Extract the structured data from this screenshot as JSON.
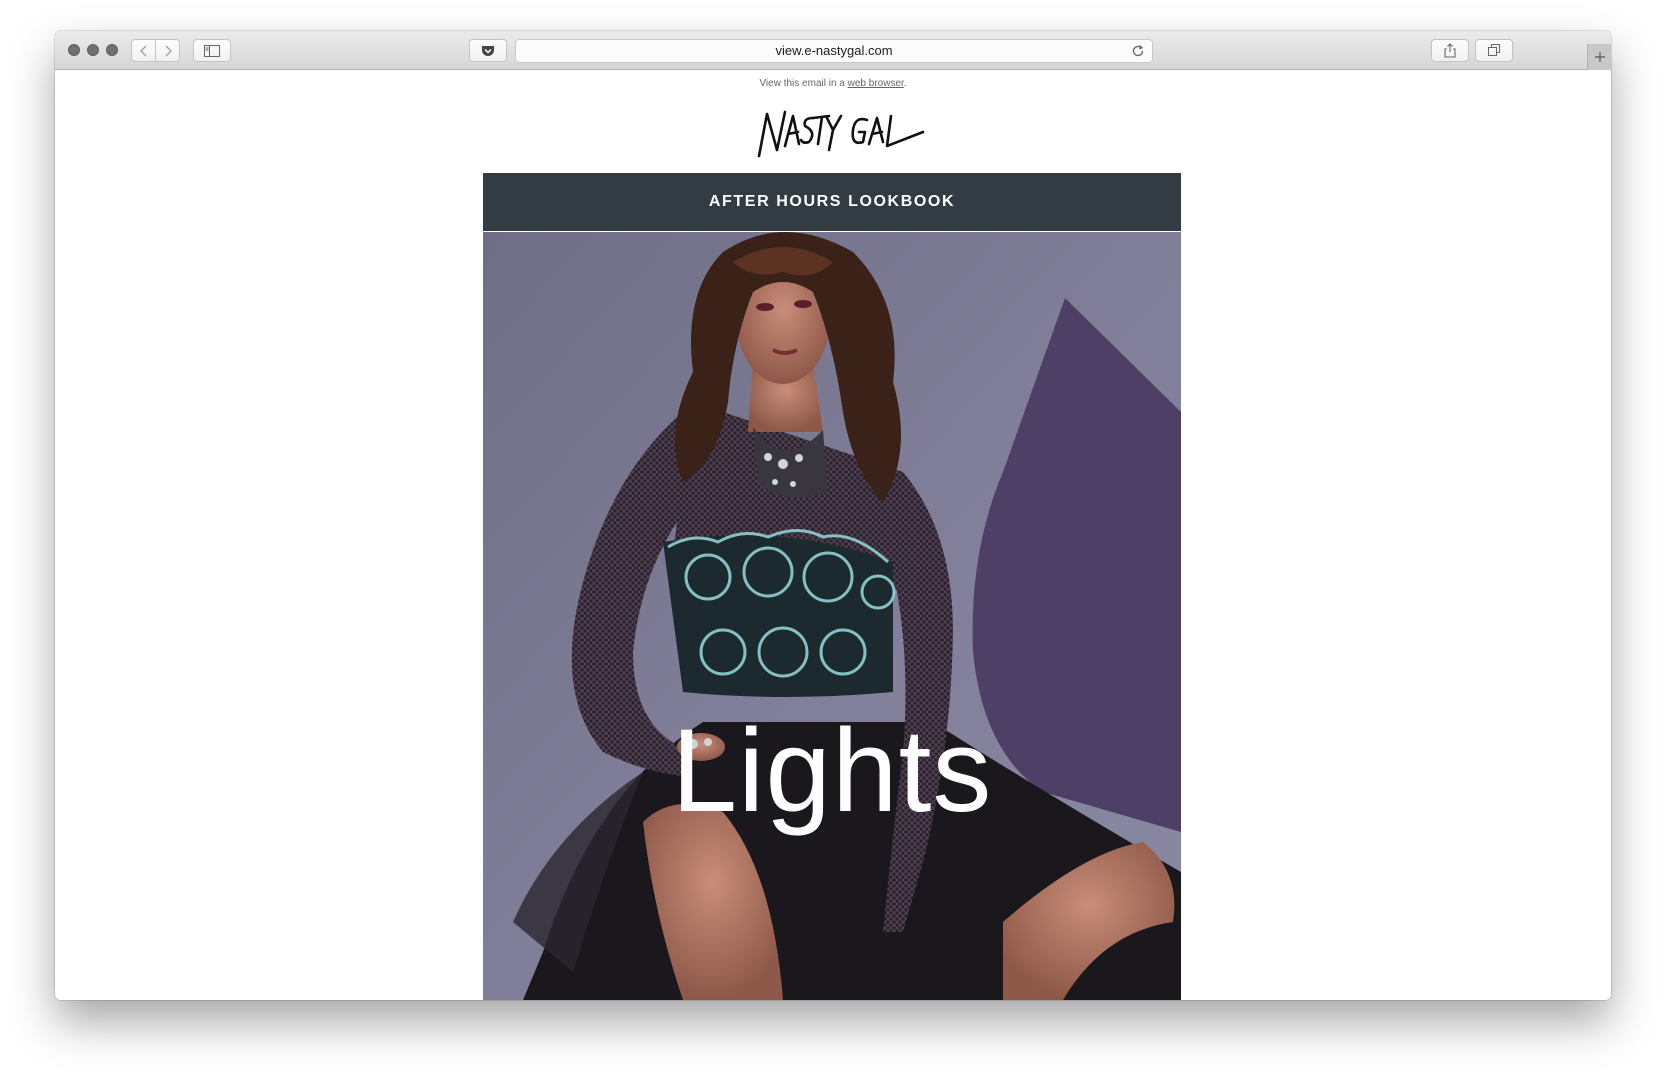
{
  "browser": {
    "url": "view.e-nastygal.com"
  },
  "email": {
    "preheader_prefix": "View this email in a",
    "preheader_link": "web browser",
    "preheader_suffix": ".",
    "brand_logo_text": "NASTY GAL",
    "banner_title": "AFTER HOURS LOOKBOOK",
    "hero_word": "Lights"
  },
  "colors": {
    "banner_bg": "#333c42",
    "hero_bg": "#7c7a94",
    "accent_shape": "#4e3f66"
  },
  "icons": {
    "toolbar": [
      "back-icon",
      "forward-icon",
      "sidebar-icon",
      "pocket-icon",
      "reload-icon",
      "share-icon",
      "tabs-icon",
      "plus-icon"
    ]
  }
}
